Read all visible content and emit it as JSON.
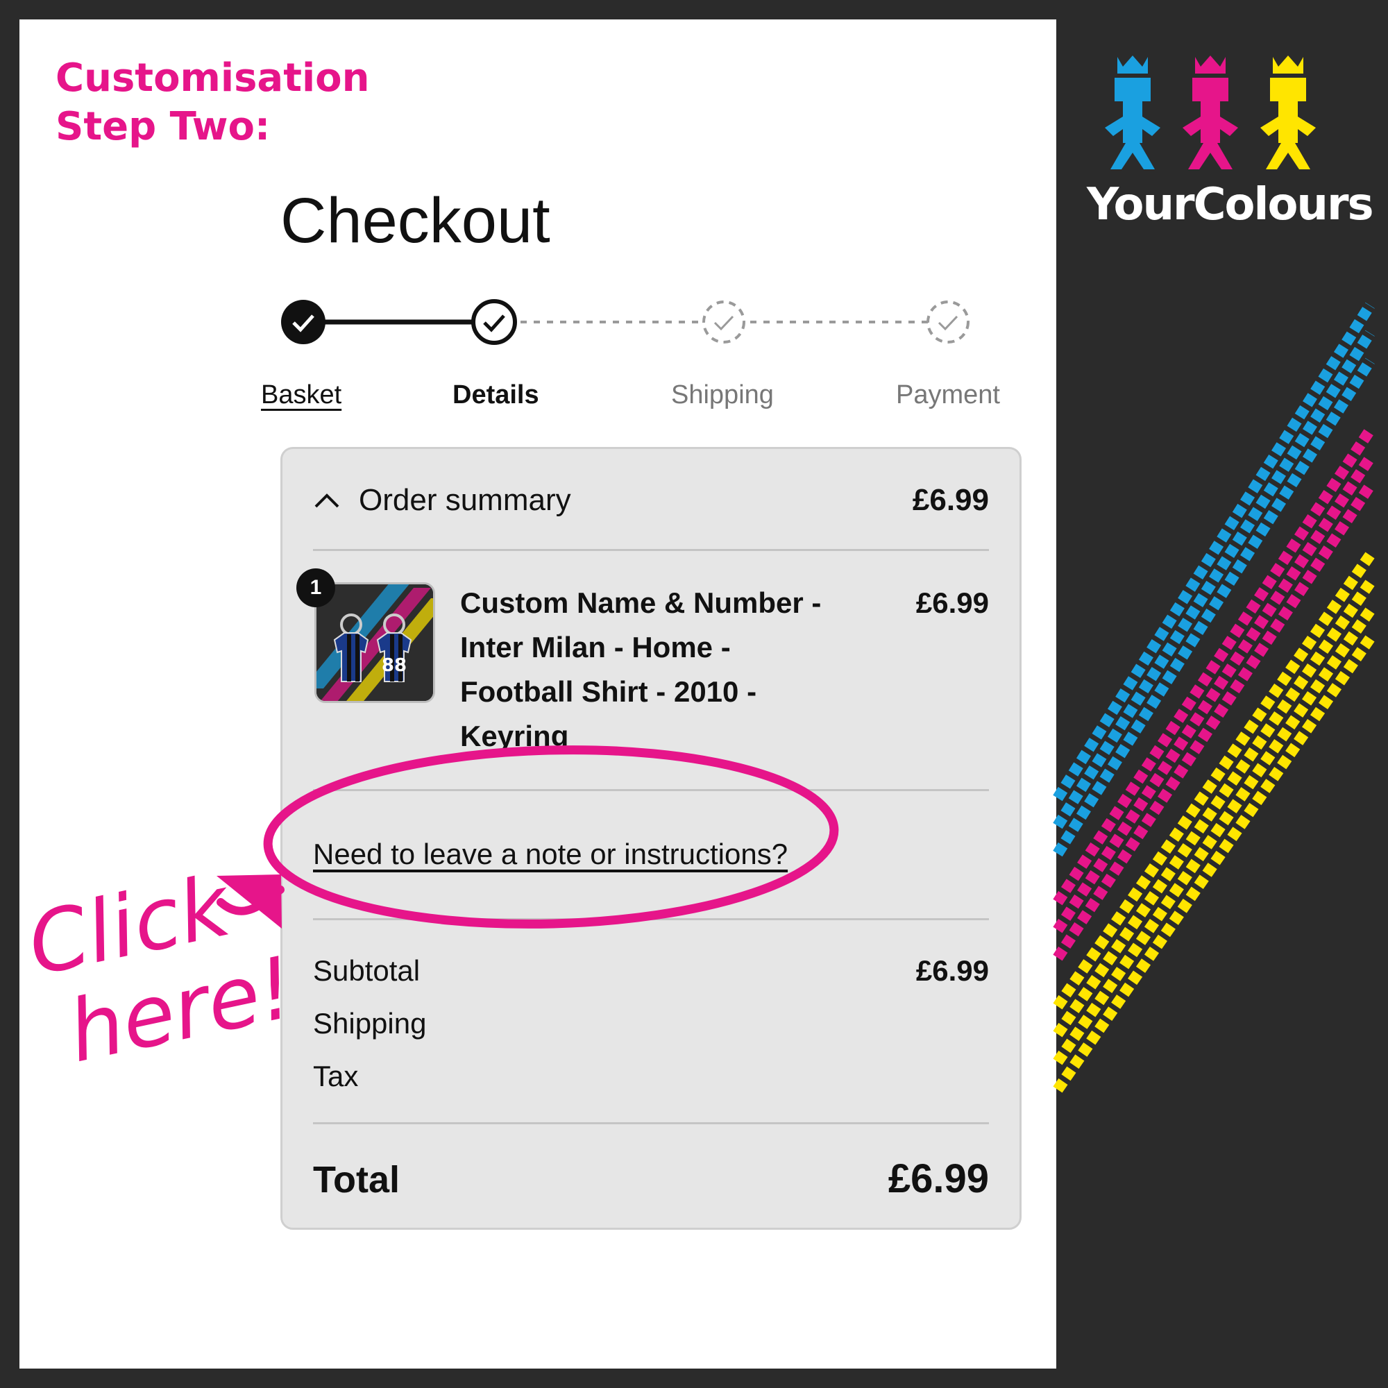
{
  "banner": {
    "heading_line1": "Customisation",
    "heading_line2": "Step Two:",
    "brand": "YourColours",
    "callout_line1": "Click",
    "callout_line2": "here!",
    "accent_color": "#e6158a",
    "brand_colors": [
      "#1aa0e0",
      "#e6158a",
      "#ffe500"
    ]
  },
  "checkout": {
    "title": "Checkout",
    "steps": [
      {
        "label": "Basket",
        "state": "complete"
      },
      {
        "label": "Details",
        "state": "current"
      },
      {
        "label": "Shipping",
        "state": "pending"
      },
      {
        "label": "Payment",
        "state": "pending"
      }
    ]
  },
  "summary": {
    "toggle_label": "Order summary",
    "toggle_icon": "chevron-up-icon",
    "header_price": "£6.99",
    "item": {
      "quantity": "1",
      "title": "Custom Name & Number - Inter Milan - Home - Football Shirt - 2010 - Keyring",
      "price": "£6.99",
      "image_number": "88"
    },
    "note_link": "Need to leave a note or instructions?",
    "rows": [
      {
        "label": "Subtotal",
        "value": "£6.99"
      },
      {
        "label": "Shipping",
        "value": ""
      },
      {
        "label": "Tax",
        "value": ""
      }
    ],
    "total_label": "Total",
    "total_value": "£6.99"
  }
}
